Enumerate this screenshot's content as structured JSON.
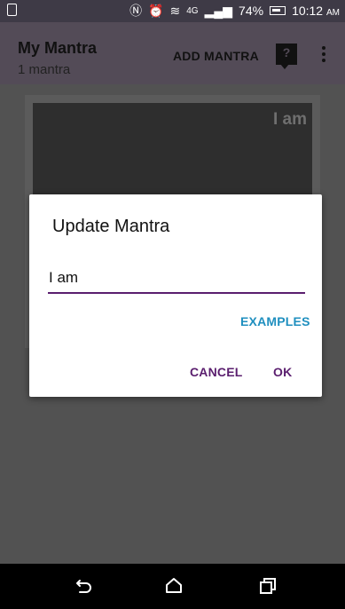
{
  "status_bar": {
    "left_icon": "screen-mirror-icon",
    "icons": [
      "nfc-icon",
      "alarm-icon",
      "wifi-icon",
      "signal-icon"
    ],
    "network": "4G",
    "battery": "74%",
    "time": "10:12",
    "ampm": "AM"
  },
  "app_bar": {
    "title": "My Mantra",
    "subtitle": "1 mantra",
    "add_label": "ADD MANTRA",
    "help_glyph": "?"
  },
  "card": {
    "text": "I am"
  },
  "dialog": {
    "title": "Update Mantra",
    "input_value": "I am",
    "examples_label": "EXAMPLES",
    "cancel_label": "CANCEL",
    "ok_label": "OK"
  },
  "colors": {
    "accent": "#5a1e6e",
    "link": "#1f8fbf"
  }
}
